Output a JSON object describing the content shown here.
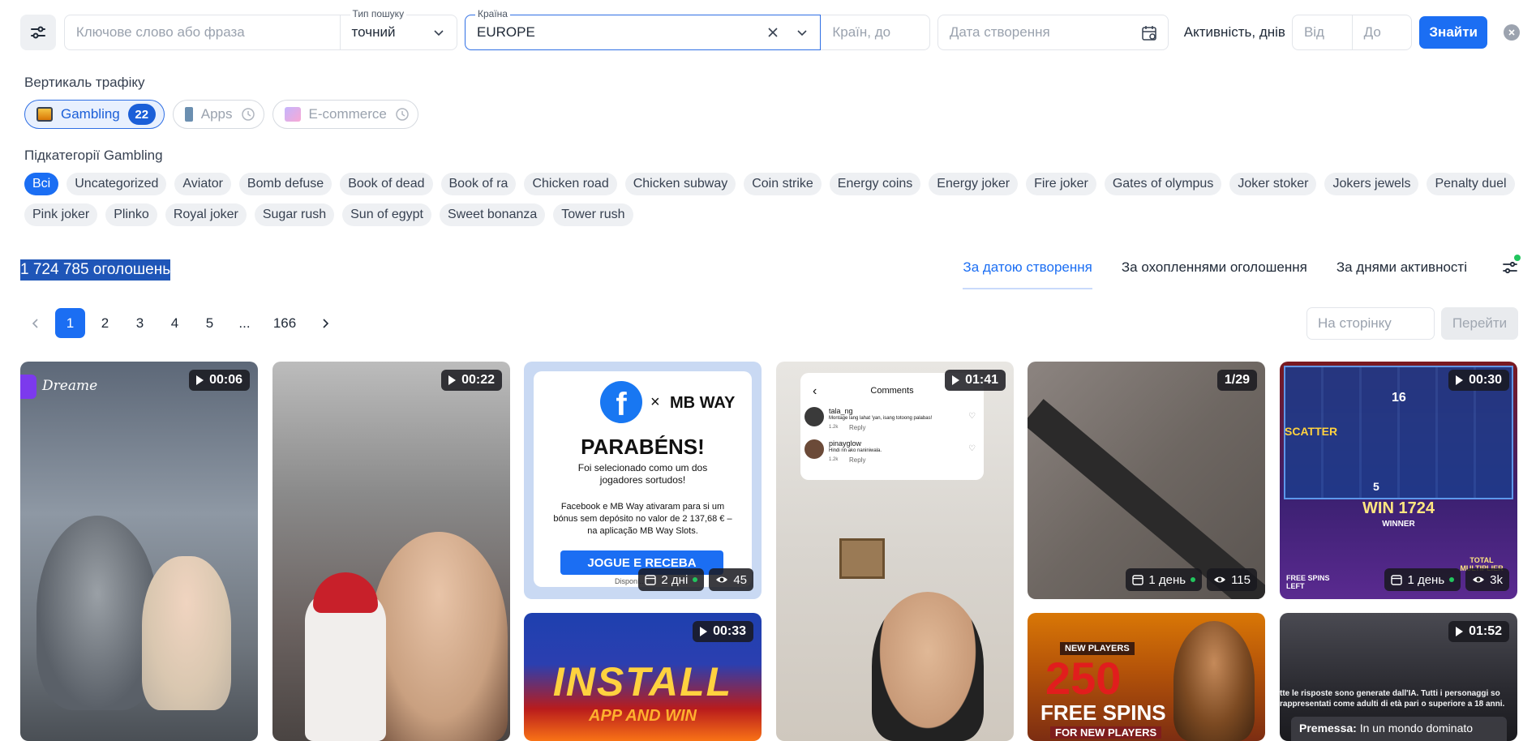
{
  "filters": {
    "keyword_placeholder": "Ключове слово або фраза",
    "search_type_label": "Тип пошуку",
    "search_type_value": "точний",
    "country_label": "Країна",
    "country_value": "EUROPE",
    "countries_to_placeholder": "Країн, до",
    "date_placeholder": "Дата створення",
    "activity_label": "Активність, днів",
    "from_placeholder": "Від",
    "to_placeholder": "До",
    "find_button": "Знайти"
  },
  "verticals": {
    "label": "Вертикаль трафіку",
    "items": [
      {
        "label": "Gambling",
        "count": "22"
      },
      {
        "label": "Apps"
      },
      {
        "label": "E-commerce"
      }
    ]
  },
  "subcategories": {
    "label": "Підкатегорії Gambling",
    "chips": [
      "Всі",
      "Uncategorized",
      "Aviator",
      "Bomb defuse",
      "Book of dead",
      "Book of ra",
      "Chicken road",
      "Chicken subway",
      "Coin strike",
      "Energy coins",
      "Energy joker",
      "Fire joker",
      "Gates of olympus",
      "Joker stoker",
      "Jokers jewels",
      "Penalty duel",
      "Pink joker",
      "Plinko",
      "Royal joker",
      "Sugar rush",
      "Sun of egypt",
      "Sweet bonanza",
      "Tower rush"
    ]
  },
  "results": {
    "total": "1 724 785 оголошень",
    "sort_tabs": [
      "За датою створення",
      "За охопленнями оголошення",
      "За днями активності"
    ]
  },
  "pagination": {
    "pages": [
      "1",
      "2",
      "3",
      "4",
      "5",
      "...",
      "166"
    ],
    "goto_placeholder": "На сторінку",
    "goto_button": "Перейти"
  },
  "cards": {
    "c1": {
      "duration": "00:06",
      "brand": "Dreame"
    },
    "c2": {
      "duration": "00:22"
    },
    "c3": {
      "times": "×",
      "mbway": "MB WAY",
      "headline": "PARABÉNS!",
      "line1": "Foi selecionado como um dos jogadores sortudos!",
      "line2": "Facebook e MB Way ativaram para si um bónus sem depósito no valor de 2 137,68 € – na aplicação MB Way Slots.",
      "cta": "JOGUE E RECEBA",
      "footer": "Disponí...",
      "days": "2 дні",
      "views": "45"
    },
    "c4": {
      "duration": "01:41",
      "comments_title": "Comments",
      "user1": "tala_ng",
      "comment1": "Montage lang lahat 'yan, isang totoong palabas!",
      "likes1": "1.2k",
      "reply": "Reply",
      "user2": "pinayglow",
      "comment2": "Hindi rin ako naniniwala.",
      "likes2": "1.2k"
    },
    "c5": {
      "counter": "1/29",
      "days": "1 день",
      "views": "115"
    },
    "c6": {
      "duration": "00:30",
      "scatter": "SCATTER",
      "num16": "16",
      "num5": "5",
      "win": "WIN 1724",
      "winner": "WINNER",
      "free_spins": "FREE SPINS LEFT",
      "total_mult": "TOTAL MULTIPLIER",
      "days": "1 день",
      "views": "3k"
    },
    "c7": {
      "duration": "00:33",
      "install": "INSTALL",
      "sub": "APP AND WIN"
    },
    "c8": {
      "new_players": "NEW PLAYERS",
      "num": "250",
      "free_spins": "FREE SPINS",
      "for_new": "FOR NEW PLAYERS"
    },
    "c9": {
      "duration": "01:52",
      "disclaimer": "tte le risposte sono generate dall'IA. Tutti i personaggi so rappresentati come adulti di età pari o superiore a 18 anni.",
      "premise_label": "Premessa:",
      "premise_text": "In un mondo dominato"
    }
  }
}
